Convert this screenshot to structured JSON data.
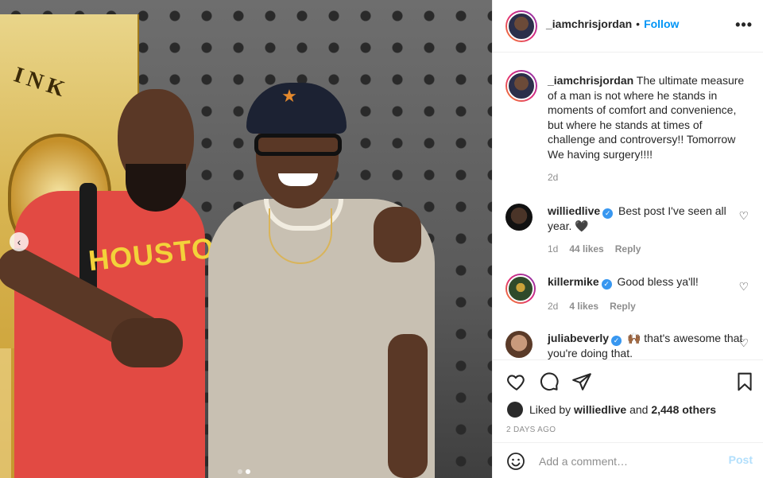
{
  "post_header": {
    "username": "_iamchrisjordan",
    "separator": "•",
    "follow_label": "Follow",
    "more_label": "•••"
  },
  "photo": {
    "shirt_text": "HOUSTON",
    "banner_text": "INK",
    "prev_label": "‹",
    "carousel_count": 2,
    "carousel_active": 2
  },
  "caption": {
    "username": "_iamchrisjordan",
    "text": "The ultimate measure of a man is not where he stands in moments of comfort and convenience, but where he stands at times of challenge and controversy!! Tomorrow We having surgery!!!!",
    "time": "2d"
  },
  "comments": [
    {
      "username": "williedlive",
      "verified": true,
      "text": "Best post I've seen all year. 🖤",
      "time": "1d",
      "likes": "44 likes",
      "reply": "Reply"
    },
    {
      "username": "killermike",
      "verified": true,
      "text": "Good bless ya'll!",
      "time": "2d",
      "likes": "4 likes",
      "reply": "Reply"
    },
    {
      "username": "juliabeverly",
      "verified": true,
      "text": "🙌🏾 that's awesome that you're doing that.",
      "time": "",
      "likes": "",
      "reply": ""
    }
  ],
  "actions": {
    "liked_by_prefix": "Liked by",
    "liked_by_user": "williedlive",
    "liked_by_and": "and",
    "liked_by_others": "2,448 others",
    "date": "2 DAYS AGO"
  },
  "add_comment": {
    "placeholder": "Add a comment…",
    "post_label": "Post"
  },
  "icons": {
    "heart": "heart-icon",
    "comment": "comment-icon",
    "share": "share-icon",
    "save": "bookmark-icon",
    "emoji": "emoji-icon",
    "verified": "verified-badge-icon"
  },
  "colors": {
    "accent": "#0095f6",
    "verified": "#3897f0",
    "muted": "#8e8e8e",
    "post_disabled": "#b2dffc",
    "shirt_red": "#e24a43"
  }
}
